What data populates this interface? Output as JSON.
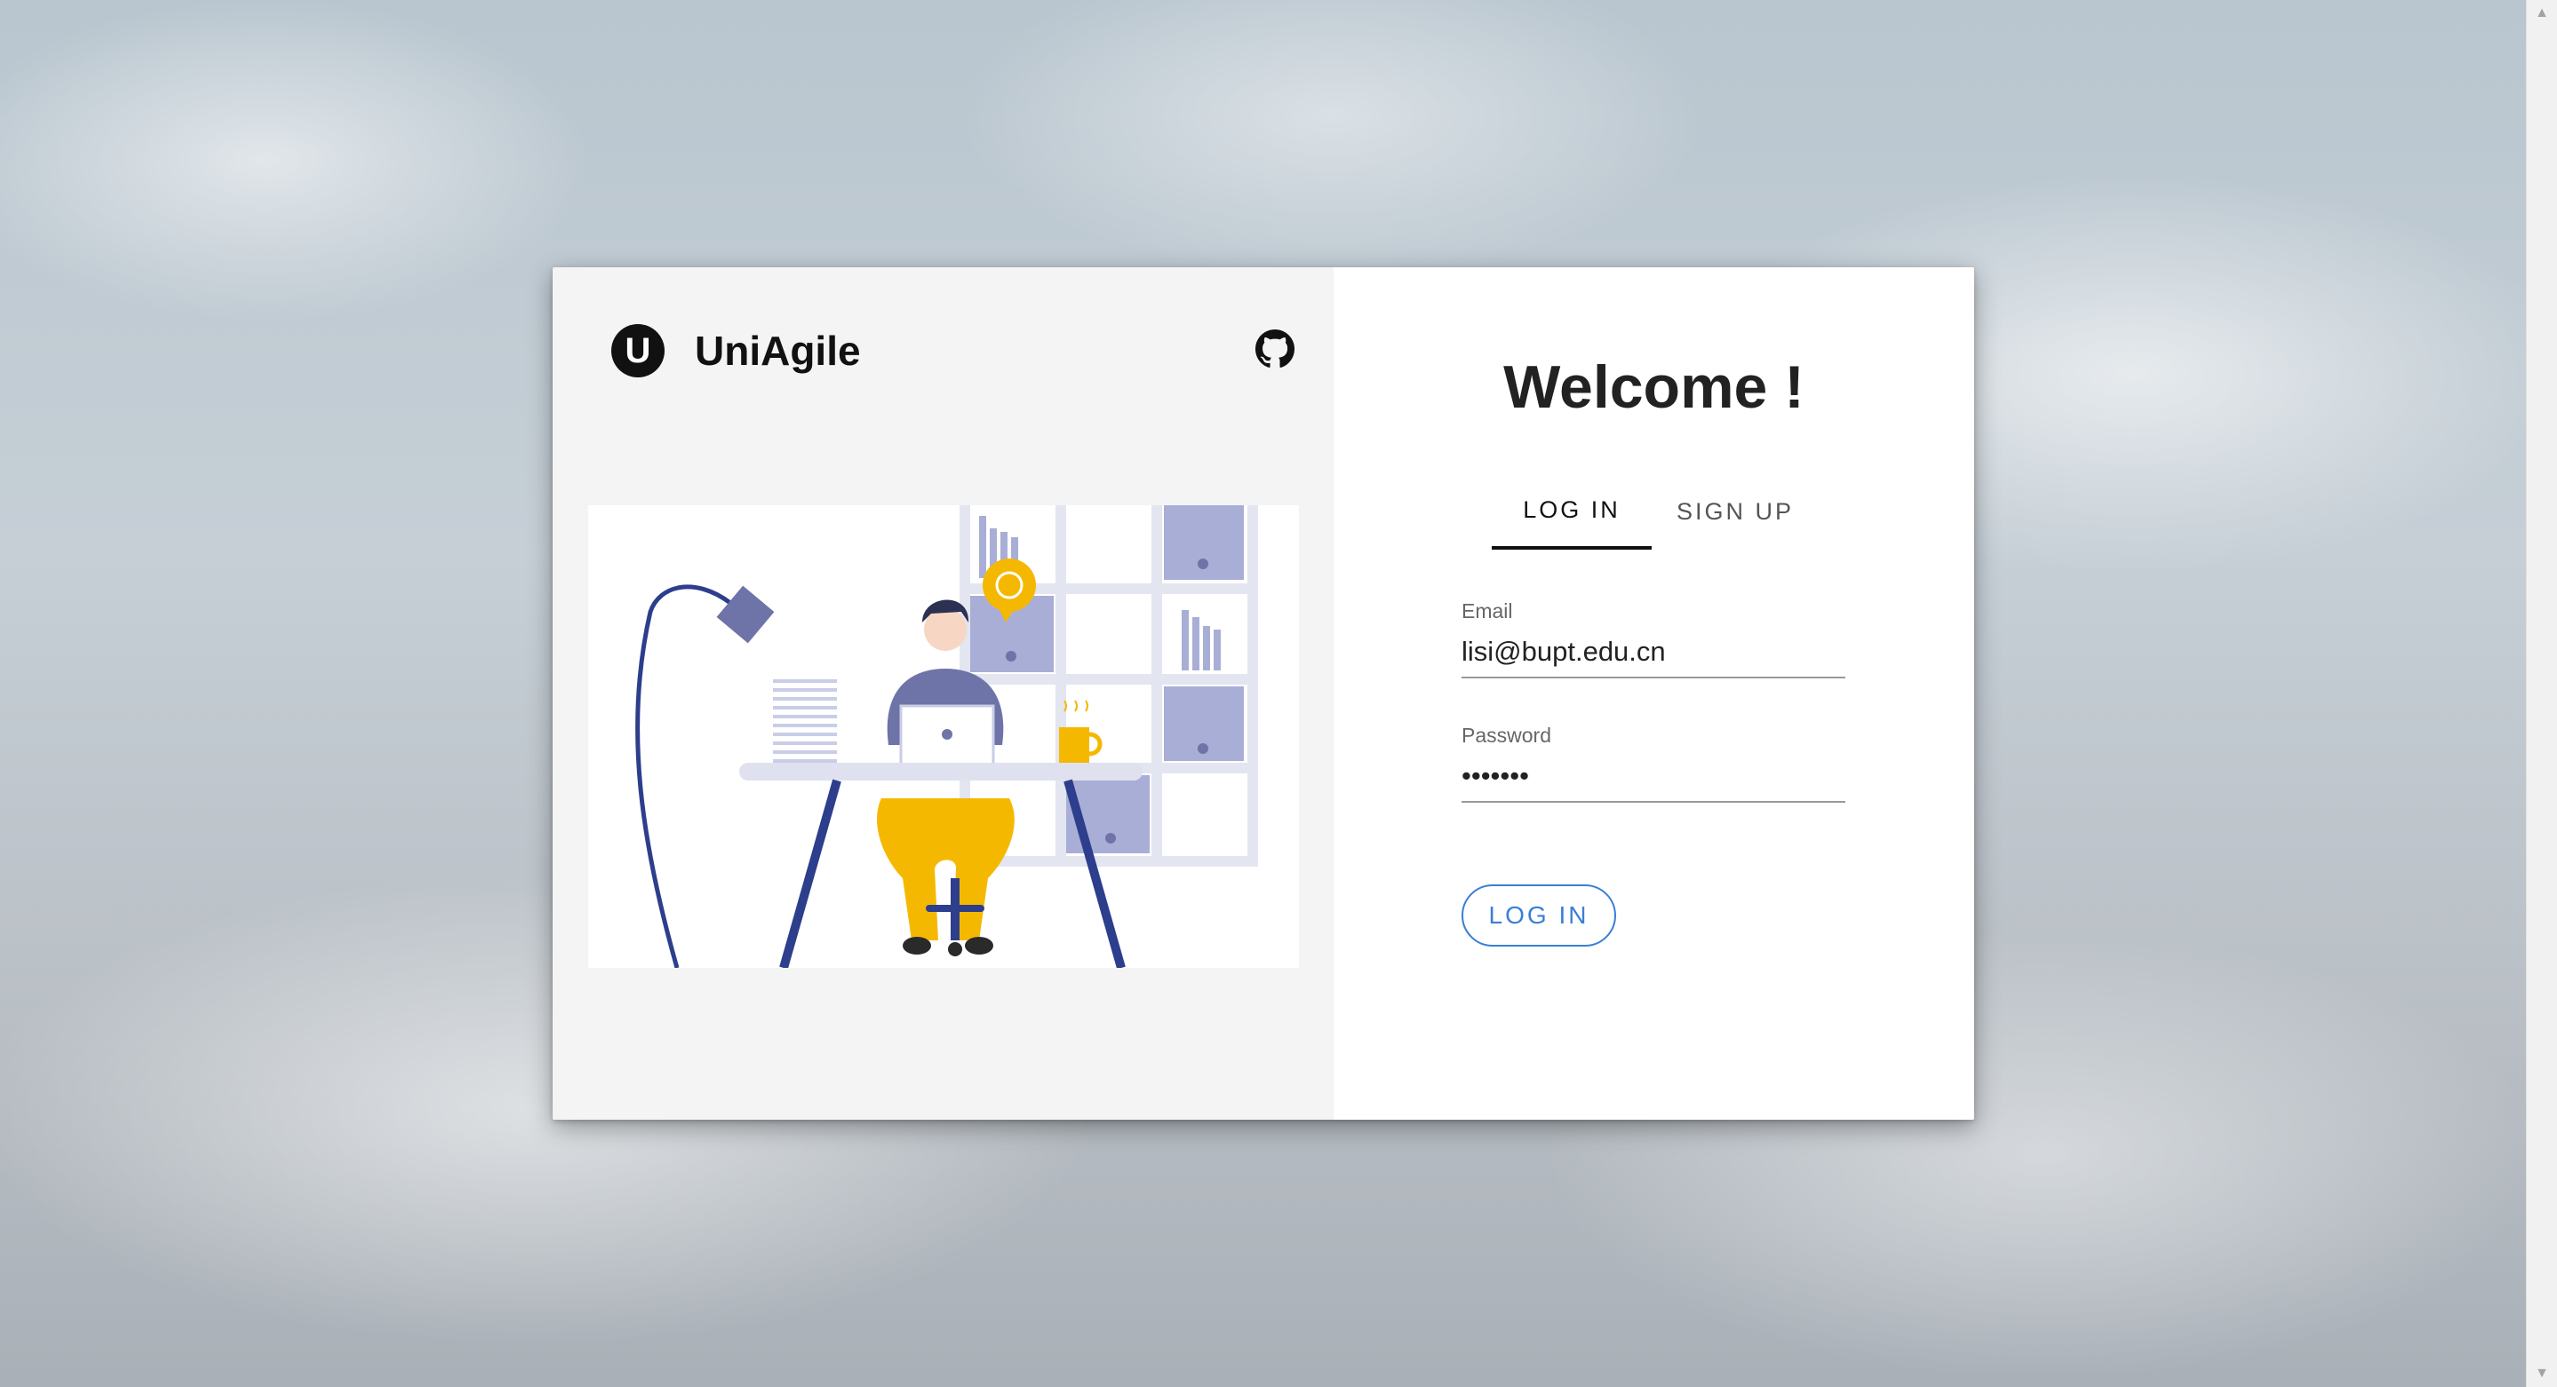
{
  "brand": {
    "logo_letter": "U",
    "name": "UniAgile"
  },
  "icons": {
    "github": "github-icon",
    "logo": "logo-mark"
  },
  "auth": {
    "welcome": "Welcome !",
    "tabs": [
      {
        "label": "LOG IN",
        "active": true
      },
      {
        "label": "SIGN UP",
        "active": false
      }
    ],
    "email": {
      "label": "Email",
      "value": "lisi@bupt.edu.cn"
    },
    "password": {
      "label": "Password",
      "value": "•••••••"
    },
    "submit_label": "LOG IN"
  },
  "colors": {
    "accent": "#3a7fd6",
    "illustration_blue": "#2c3e8c",
    "illustration_yellow": "#f5b800",
    "illustration_lavender": "#a9aed6"
  }
}
